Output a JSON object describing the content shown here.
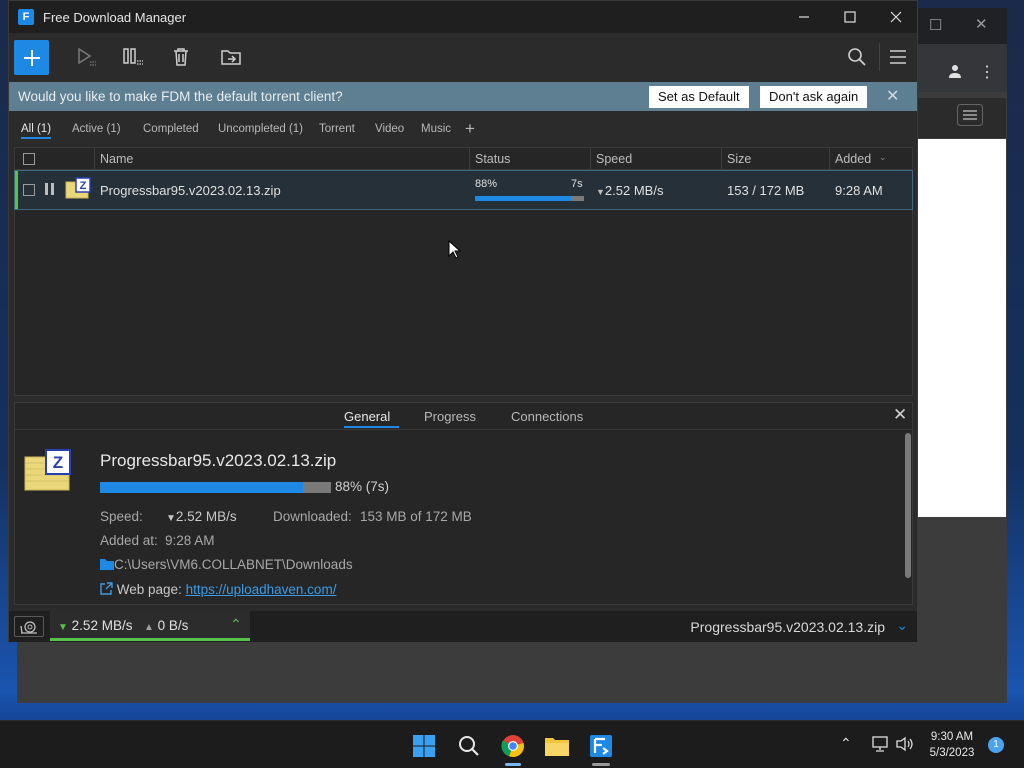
{
  "window": {
    "title": "Free Download Manager",
    "icon_letter": "F"
  },
  "banner": {
    "text": "Would you like to make FDM the default torrent client?",
    "set_default": "Set as Default",
    "dont_ask": "Don't ask again"
  },
  "filters": [
    {
      "label": "All (1)",
      "active": true
    },
    {
      "label": "Active (1)"
    },
    {
      "label": "Completed"
    },
    {
      "label": "Uncompleted (1)"
    },
    {
      "label": "Torrent"
    },
    {
      "label": "Video"
    },
    {
      "label": "Music"
    }
  ],
  "columns": {
    "name": "Name",
    "status": "Status",
    "speed": "Speed",
    "size": "Size",
    "added": "Added"
  },
  "download": {
    "name": "Progressbar95.v2023.02.13.zip",
    "percent": "88%",
    "percent_value": 88,
    "remaining": "7s",
    "speed": "2.52 MB/s",
    "size": "153 / 172 MB",
    "added": "9:28 AM",
    "icon_letter": "Z"
  },
  "details": {
    "tabs": [
      "General",
      "Progress",
      "Connections"
    ],
    "title": "Progressbar95.v2023.02.13.zip",
    "progress_text": "88% (7s)",
    "speed_label": "Speed:",
    "speed_value": "2.52 MB/s",
    "downloaded_label": "Downloaded:",
    "downloaded_value": "153 MB of 172 MB",
    "added_label": "Added at:",
    "added_value": "9:28 AM",
    "path": "C:\\Users\\VM6.COLLABNET\\Downloads",
    "web_label": "Web page:",
    "web_url": "https://uploadhaven.com/"
  },
  "statusbar": {
    "down": "2.52 MB/s",
    "up": "0 B/s",
    "file": "Progressbar95.v2023.02.13.zip"
  },
  "taskbar": {
    "time": "9:30 AM",
    "date": "5/3/2023",
    "notifications": "1"
  },
  "colors": {
    "accent": "#1e88e5",
    "active_green": "#56c34a",
    "banner": "#5e7e92"
  }
}
